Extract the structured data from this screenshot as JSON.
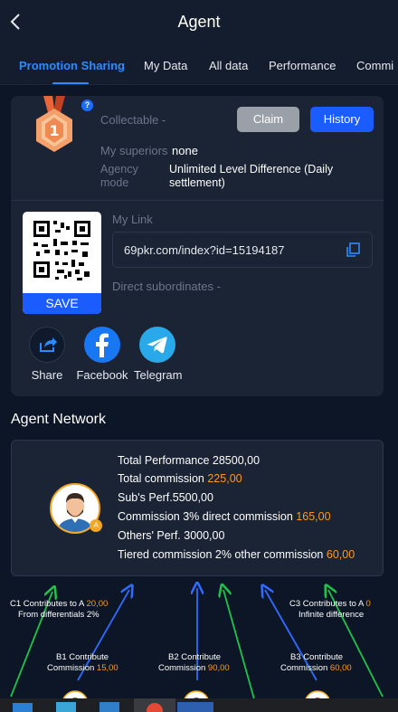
{
  "header": {
    "title": "Agent",
    "back_icon": "chevron-left-icon"
  },
  "tabs": [
    "Promotion Sharing",
    "My Data",
    "All data",
    "Performance",
    "Commi"
  ],
  "active_tab": "Promotion Sharing",
  "rank": {
    "level": "1"
  },
  "info": {
    "collectable_label": "Collectable -",
    "claim_label": "Claim",
    "history_label": "History",
    "superiors_label": "My superiors",
    "superiors_value": "none",
    "agency_mode_label_1": "Agency",
    "agency_mode_label_2": "mode",
    "agency_mode_value_1": "Unlimited Level Difference (Daily",
    "agency_mode_value_2": "settlement)"
  },
  "link": {
    "my_link_label": "My Link",
    "url": "69pkr.com/index?id=15194187",
    "save_label": "SAVE",
    "direct_subordinates_label": "Direct subordinates -"
  },
  "share": [
    {
      "label": "Share",
      "icon": "share-icon"
    },
    {
      "label": "Facebook",
      "icon": "facebook-icon"
    },
    {
      "label": "Telegram",
      "icon": "telegram-icon"
    }
  ],
  "network": {
    "title": "Agent Network",
    "total_performance": "Total Performance 28500,00",
    "total_commission_label": "Total commission",
    "total_commission_value": "225,00",
    "subs_perf": "Sub's Perf.5500,00",
    "commission_direct_label": "Commission 3% direct commission",
    "commission_direct_value": "165,00",
    "others_perf": "Others' Perf. 3000,00",
    "tiered_label": "Tiered commission 2% other commission",
    "tiered_value": "60,00",
    "avatar_badge": "A"
  },
  "diagram": {
    "c1_line1_label": "C1 Contributes to A",
    "c1_line1_value": "20,00",
    "c1_line2": "From differentials 2%",
    "c3_line1_label": "C3 Contributes to A",
    "c3_line1_value": "0",
    "c3_line2": "Infinite difference",
    "b1_line1": "B1 Contribute",
    "b1_line2_label": "Commission",
    "b1_line2_value": "15,00",
    "b2_line1": "B2 Contribute",
    "b2_line2_label": "Commission",
    "b2_line2_value": "90,00",
    "b3_line1": "B3 Contribute",
    "b3_line2_label": "Commission",
    "b3_line2_value": "60,00"
  },
  "colors": {
    "accent": "#1a5cff",
    "highlight": "#ff9a1f",
    "background": "#0d1626",
    "card": "#1a2435"
  }
}
